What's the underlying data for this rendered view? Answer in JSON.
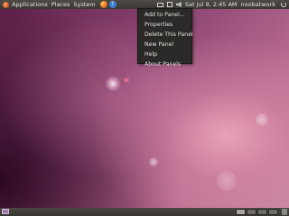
{
  "top_panel": {
    "menus": {
      "applications": "Applications",
      "places": "Places",
      "system": "System"
    },
    "clock": "Sat Jul  9,  2:45 AM",
    "username": "noobatwork"
  },
  "context_menu": {
    "items": [
      "Add to Panel...",
      "Properties",
      "Delete This Panel",
      "New Panel",
      "Help",
      "About Panels"
    ]
  },
  "icons": {
    "logo": "ubuntu-logo-icon",
    "browser": "firefox-icon",
    "help": "help-icon",
    "mail": "mail-icon",
    "network": "network-icon",
    "volume": "volume-icon",
    "power": "power-icon",
    "show_desktop": "show-desktop-icon",
    "trash": "trash-icon"
  },
  "colors": {
    "panel": "#3f3d39",
    "menu_bg": "#2b2927",
    "wallpaper_dark": "#5e1e49",
    "wallpaper_light": "#c98aa2"
  }
}
